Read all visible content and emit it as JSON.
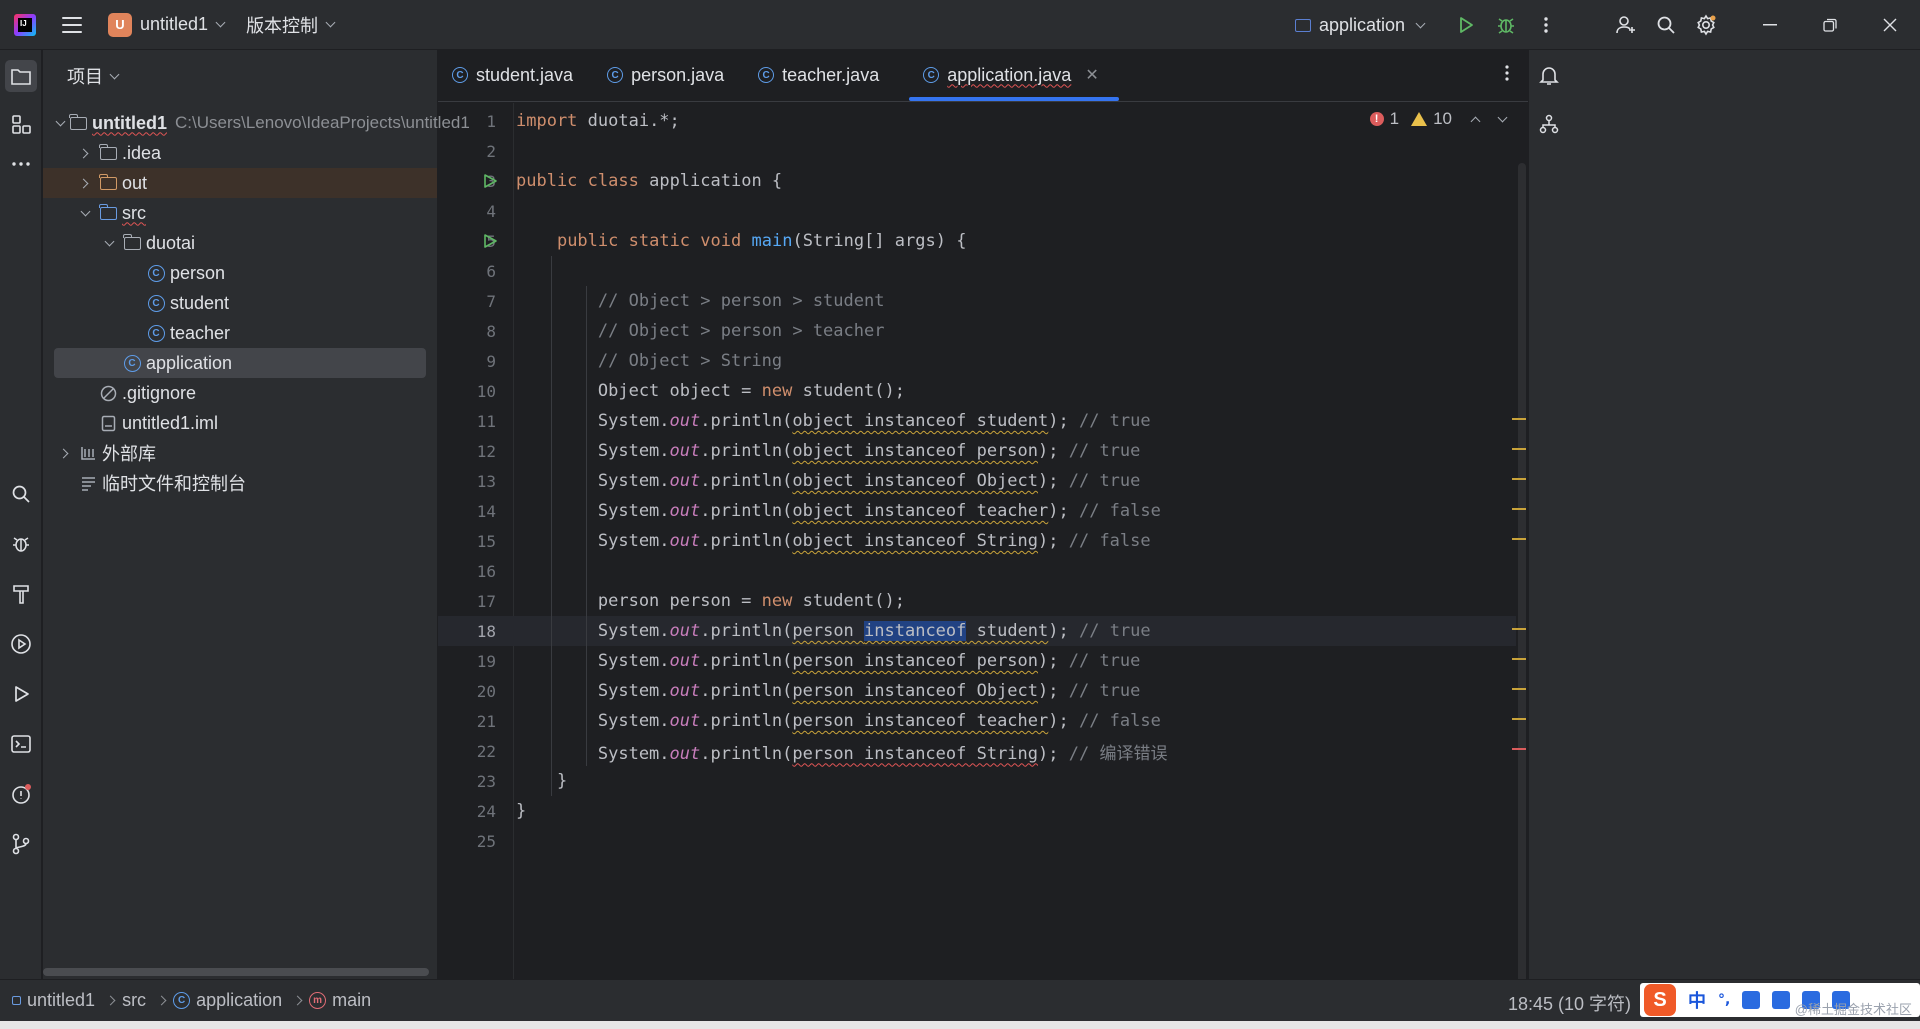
{
  "titlebar": {
    "project_badge": "U",
    "project_name": "untitled1",
    "vcs_label": "版本控制",
    "run_config": "application",
    "icons": [
      "app-logo-icon",
      "hamburger-menu-icon",
      "run-icon",
      "debug-icon",
      "more-vertical-icon",
      "add-user-icon",
      "search-icon",
      "settings-icon"
    ],
    "logo_text": "IJ"
  },
  "project_panel": {
    "header": "项目",
    "items": [
      {
        "label": "untitled1",
        "path": "C:\\Users\\Lenovo\\IdeaProjects\\untitled1"
      },
      {
        "label": ".idea"
      },
      {
        "label": "out"
      },
      {
        "label": "src"
      },
      {
        "label": "duotai"
      },
      {
        "label": "person"
      },
      {
        "label": "student"
      },
      {
        "label": "teacher"
      },
      {
        "label": "application"
      },
      {
        "label": ".gitignore"
      },
      {
        "label": "untitled1.iml"
      },
      {
        "label": "外部库"
      },
      {
        "label": "临时文件和控制台"
      }
    ]
  },
  "tabs": [
    {
      "label": "student.java"
    },
    {
      "label": "person.java"
    },
    {
      "label": "teacher.java"
    },
    {
      "label": "application.java"
    }
  ],
  "inspections": {
    "errors": "1",
    "warnings": "10"
  },
  "editor": {
    "current_line": 18,
    "lines": [
      "import duotai.*;",
      "",
      "public class application {",
      "",
      "    public static void main(String[] args) {",
      "",
      "        // Object > person > student",
      "        // Object > person > teacher",
      "        // Object > String",
      "        Object object = new student();",
      "        System.out.println(object instanceof student); // true",
      "        System.out.println(object instanceof person); // true",
      "        System.out.println(object instanceof Object); // true",
      "        System.out.println(object instanceof teacher); // false",
      "        System.out.println(object instanceof String); // false",
      "",
      "        person person = new student();",
      "        System.out.println(person instanceof student); // true",
      "        System.out.println(person instanceof person); // true",
      "        System.out.println(person instanceof Object); // true",
      "        System.out.println(person instanceof teacher); // false",
      "        System.out.println(person instanceof String); // 编译错误",
      "    }",
      "}",
      ""
    ]
  },
  "statusbar": {
    "breadcrumbs": [
      "untitled1",
      "src",
      "application",
      "main"
    ],
    "position": "18:45 (10 字符)",
    "ime_lang": "中",
    "ime_punct": "°,",
    "watermark": "@稀土掘金技术社区"
  },
  "colors": {
    "accent": "#3574f0",
    "keyword": "#cf8e6d",
    "function": "#56a8f5",
    "comment": "#7a7e85",
    "static_field": "#c77dbb",
    "error": "#db5c5c",
    "warning": "#e9c04b"
  }
}
